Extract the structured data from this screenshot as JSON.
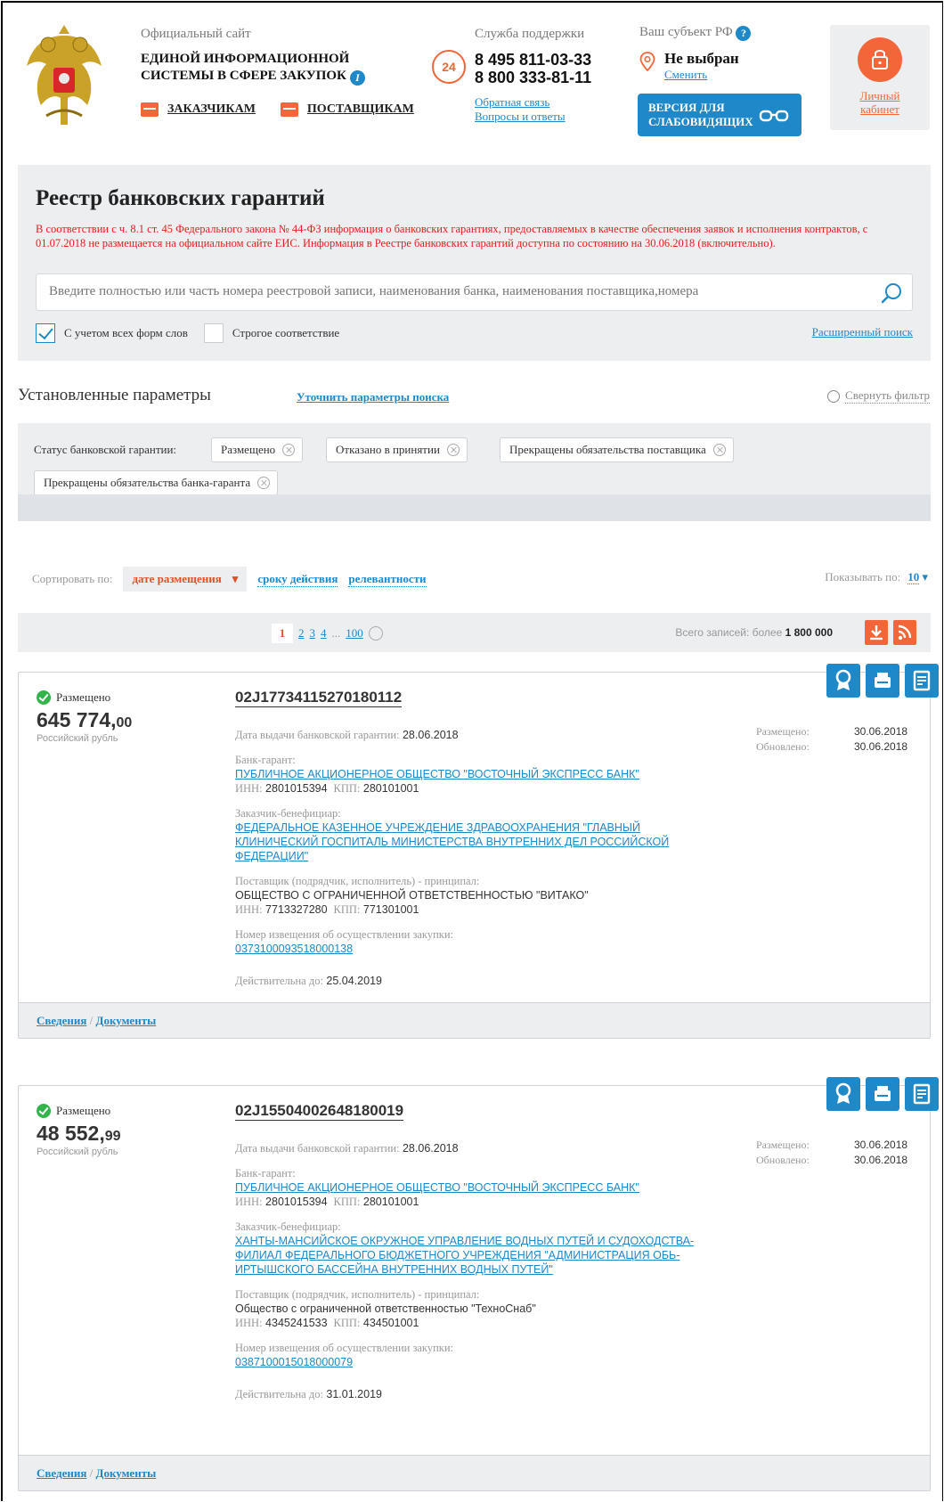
{
  "header": {
    "site_line1": "Официальный сайт",
    "site_line2": "ЕДИНОЙ ИНФОРМАЦИОННОЙ",
    "site_line3": "СИСТЕМЫ В СФЕРЕ ЗАКУПОК",
    "customers": "ЗАКАЗЧИКАМ",
    "suppliers": "ПОСТАВЩИКАМ",
    "support_title": "Служба поддержки",
    "support_badge": "24",
    "phone1": "8 495 811-03-33",
    "phone2": "8 800 333-81-11",
    "feedback": "Обратная связь",
    "faq": "Вопросы и ответы",
    "region_title": "Ваш субъект РФ",
    "region_value": "Не выбран",
    "region_change": "Сменить",
    "vision_line1": "ВЕРСИЯ ДЛЯ",
    "vision_line2": "СЛАБОВИДЯЩИХ",
    "cabinet_line1": "Личный",
    "cabinet_line2": "кабинет"
  },
  "search": {
    "title": "Реестр банковских гарантий",
    "warning": "В соответствии с ч. 8.1 ст. 45 Федерального закона № 44-ФЗ информация о банковских гарантиях, предоставляемых в качестве обеспечения заявок и исполнения контрактов, с 01.07.2018 не размещается на официальном сайте ЕИС. Информация в Реестре банковских гарантий доступна по состоянию на 30.06.2018 (включительно).",
    "placeholder": "Введите полностью или часть номера реестровой записи, наименования банка, наименования поставщика,номера",
    "all_forms": "С учетом всех форм слов",
    "all_forms_checked": true,
    "strict": "Строгое соответствие",
    "strict_checked": false,
    "advanced": "Расширенный поиск"
  },
  "params": {
    "title": "Установленные параметры",
    "refine": "Уточнить параметры поиска",
    "collapse": "Свернуть фильтр",
    "status_label": "Статус банковской гарантии:",
    "tags": [
      "Размещено",
      "Отказано в принятии",
      "Прекращены обязательства поставщика",
      "Прекращены обязательства банка-гаранта"
    ]
  },
  "sort": {
    "label": "Сортировать по:",
    "active": "дате размещения",
    "opt1": "сроку действия",
    "opt2": "релевантности",
    "show_label": "Показывать по:",
    "show_value": "10"
  },
  "pager": {
    "current": "1",
    "p2": "2",
    "p3": "3",
    "p4": "4",
    "ellipsis": "...",
    "last": "100",
    "total_label": "Всего записей: более",
    "total_value": "1 800 000"
  },
  "cards": [
    {
      "status": "Размещено",
      "amount": "645 774,",
      "cents": "00",
      "currency": "Российский рубль",
      "number": "02J17734115270180112",
      "issue_label": "Дата выдачи банковской гарантии:",
      "issue_date": "28.06.2018",
      "bank_label": "Банк-гарант:",
      "bank": "ПУБЛИЧНОЕ АКЦИОНЕРНОЕ ОБЩЕСТВО \"ВОСТОЧНЫЙ ЭКСПРЕСС БАНК\"",
      "bank_inn": "2801015394",
      "bank_kpp": "280101001",
      "customer_label": "Заказчик-бенефициар:",
      "customer": "ФЕДЕРАЛЬНОЕ КАЗЕННОЕ УЧРЕЖДЕНИЕ ЗДРАВООХРАНЕНИЯ \"ГЛАВНЫЙ КЛИНИЧЕСКИЙ ГОСПИТАЛЬ МИНИСТЕРСТВА ВНУТРЕННИХ ДЕЛ РОССИЙСКОЙ ФЕДЕРАЦИИ\"",
      "supplier_label": "Поставщик (подрядчик, исполнитель) - принципал:",
      "supplier": "ОБЩЕСТВО С ОГРАНИЧЕННОЙ ОТВЕТСТВЕННОСТЬЮ \"ВИТАКО\"",
      "supplier_inn": "7713327280",
      "supplier_kpp": "771301001",
      "notice_label": "Номер извещения об осуществлении закупки:",
      "notice": "0373100093518000138",
      "valid_label": "Действительна до:",
      "valid": "25.04.2019",
      "placed_label": "Размещено:",
      "placed": "30.06.2018",
      "updated_label": "Обновлено:",
      "updated": "30.06.2018",
      "info": "Сведения",
      "docs": "Документы"
    },
    {
      "status": "Размещено",
      "amount": "48 552,",
      "cents": "99",
      "currency": "Российский рубль",
      "number": "02J15504002648180019",
      "issue_label": "Дата выдачи банковской гарантии:",
      "issue_date": "28.06.2018",
      "bank_label": "Банк-гарант:",
      "bank": "ПУБЛИЧНОЕ АКЦИОНЕРНОЕ ОБЩЕСТВО \"ВОСТОЧНЫЙ ЭКСПРЕСС БАНК\"",
      "bank_inn": "2801015394",
      "bank_kpp": "280101001",
      "customer_label": "Заказчик-бенефициар:",
      "customer": "ХАНТЫ-МАНСИЙСКОЕ ОКРУЖНОЕ УПРАВЛЕНИЕ ВОДНЫХ ПУТЕЙ И СУДОХОДСТВА-ФИЛИАЛ ФЕДЕРАЛЬНОГО БЮДЖЕТНОГО УЧРЕЖДЕНИЯ \"АДМИНИСТРАЦИЯ ОБЬ-ИРТЫШСКОГО БАССЕЙНА ВНУТРЕННИХ ВОДНЫХ ПУТЕЙ\"",
      "supplier_label": "Поставщик (подрядчик, исполнитель) - принципал:",
      "supplier": "Общество с ограниченной ответственностью \"ТехноСнаб\"",
      "supplier_inn": "4345241533",
      "supplier_kpp": "434501001",
      "notice_label": "Номер извещения об осуществлении закупки:",
      "notice": "0387100015018000079",
      "valid_label": "Действительна до:",
      "valid": "31.01.2019",
      "placed_label": "Размещено:",
      "placed": "30.06.2018",
      "updated_label": "Обновлено:",
      "updated": "30.06.2018",
      "info": "Сведения",
      "docs": "Документы"
    }
  ],
  "labels": {
    "inn": "ИНН:",
    "kpp": "КПП:",
    "sep": "/"
  },
  "colors": {
    "accent": "#1e88c8",
    "orange": "#f2663a",
    "warning": "#e02020",
    "panel": "#eceef0"
  }
}
